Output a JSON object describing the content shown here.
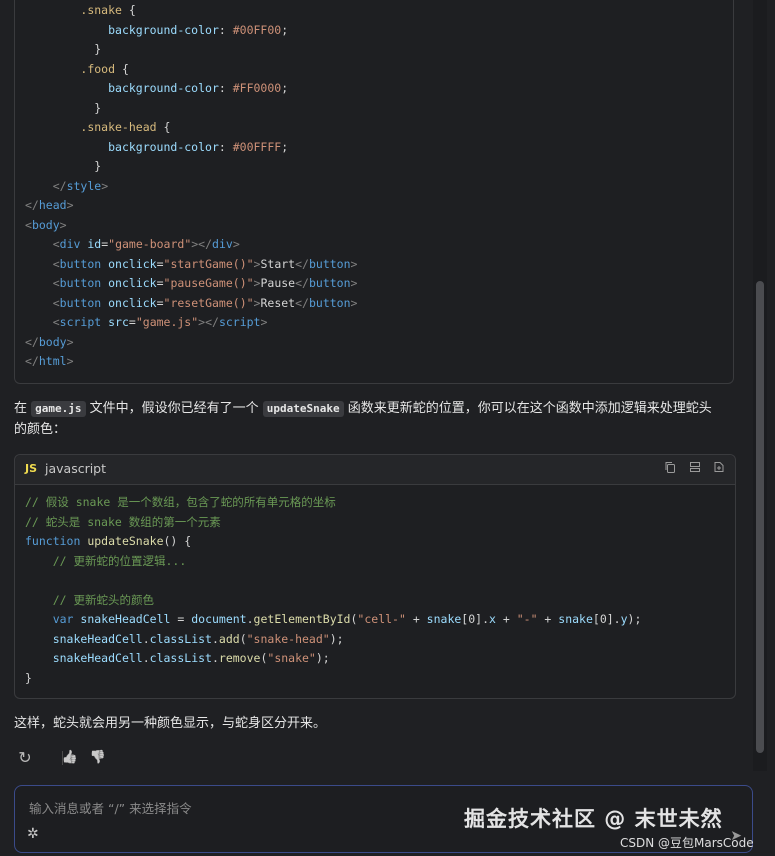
{
  "top_code": {
    "lines": [
      [
        [
          "",
          "        "
        ],
        [
          "tok-sel",
          ".snake"
        ],
        [
          "tok-plain",
          " {"
        ]
      ],
      [
        [
          "",
          "            "
        ],
        [
          "tok-prop",
          "background-color"
        ],
        [
          "tok-plain",
          ": "
        ],
        [
          "tok-str",
          "#00FF00"
        ],
        [
          "tok-plain",
          ";"
        ]
      ],
      [
        [
          "",
          "          "
        ],
        [
          "tok-plain",
          "}"
        ]
      ],
      [
        [
          "",
          "        "
        ],
        [
          "tok-sel",
          ".food"
        ],
        [
          "tok-plain",
          " {"
        ]
      ],
      [
        [
          "",
          "            "
        ],
        [
          "tok-prop",
          "background-color"
        ],
        [
          "tok-plain",
          ": "
        ],
        [
          "tok-str",
          "#FF0000"
        ],
        [
          "tok-plain",
          ";"
        ]
      ],
      [
        [
          "",
          "          "
        ],
        [
          "tok-plain",
          "}"
        ]
      ],
      [
        [
          "",
          "        "
        ],
        [
          "tok-sel",
          ".snake-head"
        ],
        [
          "tok-plain",
          " {"
        ]
      ],
      [
        [
          "",
          "            "
        ],
        [
          "tok-prop",
          "background-color"
        ],
        [
          "tok-plain",
          ": "
        ],
        [
          "tok-str",
          "#00FFFF"
        ],
        [
          "tok-plain",
          ";"
        ]
      ],
      [
        [
          "",
          "          "
        ],
        [
          "tok-plain",
          "}"
        ]
      ],
      [
        [
          "",
          "    "
        ],
        [
          "tok-tag",
          "</"
        ],
        [
          "tok-name",
          "style"
        ],
        [
          "tok-tag",
          ">"
        ]
      ],
      [
        [
          "tok-tag",
          "</"
        ],
        [
          "tok-name",
          "head"
        ],
        [
          "tok-tag",
          ">"
        ]
      ],
      [
        [
          "tok-tag",
          "<"
        ],
        [
          "tok-name",
          "body"
        ],
        [
          "tok-tag",
          ">"
        ]
      ],
      [
        [
          "",
          "    "
        ],
        [
          "tok-tag",
          "<"
        ],
        [
          "tok-name",
          "div"
        ],
        [
          "tok-plain",
          " "
        ],
        [
          "tok-attr",
          "id"
        ],
        [
          "tok-plain",
          "="
        ],
        [
          "tok-str",
          "\"game-board\""
        ],
        [
          "tok-tag",
          "></"
        ],
        [
          "tok-name",
          "div"
        ],
        [
          "tok-tag",
          ">"
        ]
      ],
      [
        [
          "",
          "    "
        ],
        [
          "tok-tag",
          "<"
        ],
        [
          "tok-name",
          "button"
        ],
        [
          "tok-plain",
          " "
        ],
        [
          "tok-attr",
          "onclick"
        ],
        [
          "tok-plain",
          "="
        ],
        [
          "tok-str",
          "\"startGame()\""
        ],
        [
          "tok-tag",
          ">"
        ],
        [
          "tok-plain",
          "Start"
        ],
        [
          "tok-tag",
          "</"
        ],
        [
          "tok-name",
          "button"
        ],
        [
          "tok-tag",
          ">"
        ]
      ],
      [
        [
          "",
          "    "
        ],
        [
          "tok-tag",
          "<"
        ],
        [
          "tok-name",
          "button"
        ],
        [
          "tok-plain",
          " "
        ],
        [
          "tok-attr",
          "onclick"
        ],
        [
          "tok-plain",
          "="
        ],
        [
          "tok-str",
          "\"pauseGame()\""
        ],
        [
          "tok-tag",
          ">"
        ],
        [
          "tok-plain",
          "Pause"
        ],
        [
          "tok-tag",
          "</"
        ],
        [
          "tok-name",
          "button"
        ],
        [
          "tok-tag",
          ">"
        ]
      ],
      [
        [
          "",
          "    "
        ],
        [
          "tok-tag",
          "<"
        ],
        [
          "tok-name",
          "button"
        ],
        [
          "tok-plain",
          " "
        ],
        [
          "tok-attr",
          "onclick"
        ],
        [
          "tok-plain",
          "="
        ],
        [
          "tok-str",
          "\"resetGame()\""
        ],
        [
          "tok-tag",
          ">"
        ],
        [
          "tok-plain",
          "Reset"
        ],
        [
          "tok-tag",
          "</"
        ],
        [
          "tok-name",
          "button"
        ],
        [
          "tok-tag",
          ">"
        ]
      ],
      [
        [
          "",
          "    "
        ],
        [
          "tok-tag",
          "<"
        ],
        [
          "tok-name",
          "script"
        ],
        [
          "tok-plain",
          " "
        ],
        [
          "tok-attr",
          "src"
        ],
        [
          "tok-plain",
          "="
        ],
        [
          "tok-str",
          "\"game.js\""
        ],
        [
          "tok-tag",
          "></"
        ],
        [
          "tok-name",
          "script"
        ],
        [
          "tok-tag",
          ">"
        ]
      ],
      [
        [
          "tok-tag",
          "</"
        ],
        [
          "tok-name",
          "body"
        ],
        [
          "tok-tag",
          ">"
        ]
      ],
      [
        [
          "tok-tag",
          "</"
        ],
        [
          "tok-name",
          "html"
        ],
        [
          "tok-tag",
          ">"
        ]
      ]
    ]
  },
  "paragraph1": {
    "prefix": "在 ",
    "code1": "game.js",
    "mid1": " 文件中，假设你已经有了一个 ",
    "code2": "updateSnake",
    "mid2": " 函数来更新蛇的位置，你可以在这个函数中添加逻辑来处理蛇头",
    "line2": "的颜色："
  },
  "js_code": {
    "badge": "JS",
    "language": "javascript",
    "icons": [
      "copy-icon",
      "insert-icon",
      "new-file-icon"
    ],
    "lines": [
      [
        [
          "tok-comment",
          "// 假设 snake 是一个数组，包含了蛇的所有单元格的坐标"
        ]
      ],
      [
        [
          "tok-comment",
          "// 蛇头是 snake 数组的第一个元素"
        ]
      ],
      [
        [
          "tok-kw",
          "function"
        ],
        [
          "tok-plain",
          " "
        ],
        [
          "tok-fn",
          "updateSnake"
        ],
        [
          "tok-plain",
          "() {"
        ]
      ],
      [
        [
          "",
          "    "
        ],
        [
          "tok-comment",
          "// 更新蛇的位置逻辑..."
        ]
      ],
      [
        [
          "",
          ""
        ]
      ],
      [
        [
          "",
          "    "
        ],
        [
          "tok-comment",
          "// 更新蛇头的颜色"
        ]
      ],
      [
        [
          "",
          "    "
        ],
        [
          "tok-kw",
          "var"
        ],
        [
          "tok-plain",
          " "
        ],
        [
          "tok-attr",
          "snakeHeadCell"
        ],
        [
          "tok-plain",
          " = "
        ],
        [
          "tok-attr",
          "document"
        ],
        [
          "tok-plain",
          "."
        ],
        [
          "tok-fn",
          "getElementById"
        ],
        [
          "tok-plain",
          "("
        ],
        [
          "tok-str",
          "\"cell-\""
        ],
        [
          "tok-plain",
          " + "
        ],
        [
          "tok-attr",
          "snake"
        ],
        [
          "tok-plain",
          "[0]."
        ],
        [
          "tok-attr",
          "x"
        ],
        [
          "tok-plain",
          " + "
        ],
        [
          "tok-str",
          "\"-\""
        ],
        [
          "tok-plain",
          " + "
        ],
        [
          "tok-attr",
          "snake"
        ],
        [
          "tok-plain",
          "[0]."
        ],
        [
          "tok-attr",
          "y"
        ],
        [
          "tok-plain",
          ");"
        ]
      ],
      [
        [
          "",
          "    "
        ],
        [
          "tok-attr",
          "snakeHeadCell"
        ],
        [
          "tok-plain",
          "."
        ],
        [
          "tok-attr",
          "classList"
        ],
        [
          "tok-plain",
          "."
        ],
        [
          "tok-fn",
          "add"
        ],
        [
          "tok-plain",
          "("
        ],
        [
          "tok-str",
          "\"snake-head\""
        ],
        [
          "tok-plain",
          ");"
        ]
      ],
      [
        [
          "",
          "    "
        ],
        [
          "tok-attr",
          "snakeHeadCell"
        ],
        [
          "tok-plain",
          "."
        ],
        [
          "tok-attr",
          "classList"
        ],
        [
          "tok-plain",
          "."
        ],
        [
          "tok-fn",
          "remove"
        ],
        [
          "tok-plain",
          "("
        ],
        [
          "tok-str",
          "\"snake\""
        ],
        [
          "tok-plain",
          ");"
        ]
      ],
      [
        [
          "tok-plain",
          "}"
        ]
      ]
    ]
  },
  "paragraph2": "这样，蛇头就会用另一种颜色显示，与蛇身区分开来。",
  "actions": {
    "regenerate": "↻",
    "like": "👍",
    "dislike": "👎"
  },
  "input": {
    "placeholder": "输入消息或者 “/” 来选择指令"
  },
  "watermark": {
    "main": "掘金技术社区 @ 末世未然",
    "sub": "CSDN @豆包MarsCode"
  }
}
